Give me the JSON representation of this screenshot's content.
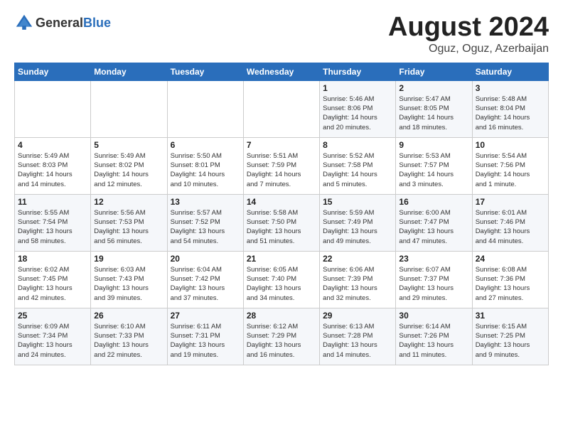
{
  "header": {
    "logo_general": "General",
    "logo_blue": "Blue",
    "month_title": "August 2024",
    "location": "Oguz, Oguz, Azerbaijan"
  },
  "weekdays": [
    "Sunday",
    "Monday",
    "Tuesday",
    "Wednesday",
    "Thursday",
    "Friday",
    "Saturday"
  ],
  "weeks": [
    [
      {
        "day": "",
        "info": ""
      },
      {
        "day": "",
        "info": ""
      },
      {
        "day": "",
        "info": ""
      },
      {
        "day": "",
        "info": ""
      },
      {
        "day": "1",
        "info": "Sunrise: 5:46 AM\nSunset: 8:06 PM\nDaylight: 14 hours\nand 20 minutes."
      },
      {
        "day": "2",
        "info": "Sunrise: 5:47 AM\nSunset: 8:05 PM\nDaylight: 14 hours\nand 18 minutes."
      },
      {
        "day": "3",
        "info": "Sunrise: 5:48 AM\nSunset: 8:04 PM\nDaylight: 14 hours\nand 16 minutes."
      }
    ],
    [
      {
        "day": "4",
        "info": "Sunrise: 5:49 AM\nSunset: 8:03 PM\nDaylight: 14 hours\nand 14 minutes."
      },
      {
        "day": "5",
        "info": "Sunrise: 5:49 AM\nSunset: 8:02 PM\nDaylight: 14 hours\nand 12 minutes."
      },
      {
        "day": "6",
        "info": "Sunrise: 5:50 AM\nSunset: 8:01 PM\nDaylight: 14 hours\nand 10 minutes."
      },
      {
        "day": "7",
        "info": "Sunrise: 5:51 AM\nSunset: 7:59 PM\nDaylight: 14 hours\nand 7 minutes."
      },
      {
        "day": "8",
        "info": "Sunrise: 5:52 AM\nSunset: 7:58 PM\nDaylight: 14 hours\nand 5 minutes."
      },
      {
        "day": "9",
        "info": "Sunrise: 5:53 AM\nSunset: 7:57 PM\nDaylight: 14 hours\nand 3 minutes."
      },
      {
        "day": "10",
        "info": "Sunrise: 5:54 AM\nSunset: 7:56 PM\nDaylight: 14 hours\nand 1 minute."
      }
    ],
    [
      {
        "day": "11",
        "info": "Sunrise: 5:55 AM\nSunset: 7:54 PM\nDaylight: 13 hours\nand 58 minutes."
      },
      {
        "day": "12",
        "info": "Sunrise: 5:56 AM\nSunset: 7:53 PM\nDaylight: 13 hours\nand 56 minutes."
      },
      {
        "day": "13",
        "info": "Sunrise: 5:57 AM\nSunset: 7:52 PM\nDaylight: 13 hours\nand 54 minutes."
      },
      {
        "day": "14",
        "info": "Sunrise: 5:58 AM\nSunset: 7:50 PM\nDaylight: 13 hours\nand 51 minutes."
      },
      {
        "day": "15",
        "info": "Sunrise: 5:59 AM\nSunset: 7:49 PM\nDaylight: 13 hours\nand 49 minutes."
      },
      {
        "day": "16",
        "info": "Sunrise: 6:00 AM\nSunset: 7:47 PM\nDaylight: 13 hours\nand 47 minutes."
      },
      {
        "day": "17",
        "info": "Sunrise: 6:01 AM\nSunset: 7:46 PM\nDaylight: 13 hours\nand 44 minutes."
      }
    ],
    [
      {
        "day": "18",
        "info": "Sunrise: 6:02 AM\nSunset: 7:45 PM\nDaylight: 13 hours\nand 42 minutes."
      },
      {
        "day": "19",
        "info": "Sunrise: 6:03 AM\nSunset: 7:43 PM\nDaylight: 13 hours\nand 39 minutes."
      },
      {
        "day": "20",
        "info": "Sunrise: 6:04 AM\nSunset: 7:42 PM\nDaylight: 13 hours\nand 37 minutes."
      },
      {
        "day": "21",
        "info": "Sunrise: 6:05 AM\nSunset: 7:40 PM\nDaylight: 13 hours\nand 34 minutes."
      },
      {
        "day": "22",
        "info": "Sunrise: 6:06 AM\nSunset: 7:39 PM\nDaylight: 13 hours\nand 32 minutes."
      },
      {
        "day": "23",
        "info": "Sunrise: 6:07 AM\nSunset: 7:37 PM\nDaylight: 13 hours\nand 29 minutes."
      },
      {
        "day": "24",
        "info": "Sunrise: 6:08 AM\nSunset: 7:36 PM\nDaylight: 13 hours\nand 27 minutes."
      }
    ],
    [
      {
        "day": "25",
        "info": "Sunrise: 6:09 AM\nSunset: 7:34 PM\nDaylight: 13 hours\nand 24 minutes."
      },
      {
        "day": "26",
        "info": "Sunrise: 6:10 AM\nSunset: 7:33 PM\nDaylight: 13 hours\nand 22 minutes."
      },
      {
        "day": "27",
        "info": "Sunrise: 6:11 AM\nSunset: 7:31 PM\nDaylight: 13 hours\nand 19 minutes."
      },
      {
        "day": "28",
        "info": "Sunrise: 6:12 AM\nSunset: 7:29 PM\nDaylight: 13 hours\nand 16 minutes."
      },
      {
        "day": "29",
        "info": "Sunrise: 6:13 AM\nSunset: 7:28 PM\nDaylight: 13 hours\nand 14 minutes."
      },
      {
        "day": "30",
        "info": "Sunrise: 6:14 AM\nSunset: 7:26 PM\nDaylight: 13 hours\nand 11 minutes."
      },
      {
        "day": "31",
        "info": "Sunrise: 6:15 AM\nSunset: 7:25 PM\nDaylight: 13 hours\nand 9 minutes."
      }
    ]
  ]
}
